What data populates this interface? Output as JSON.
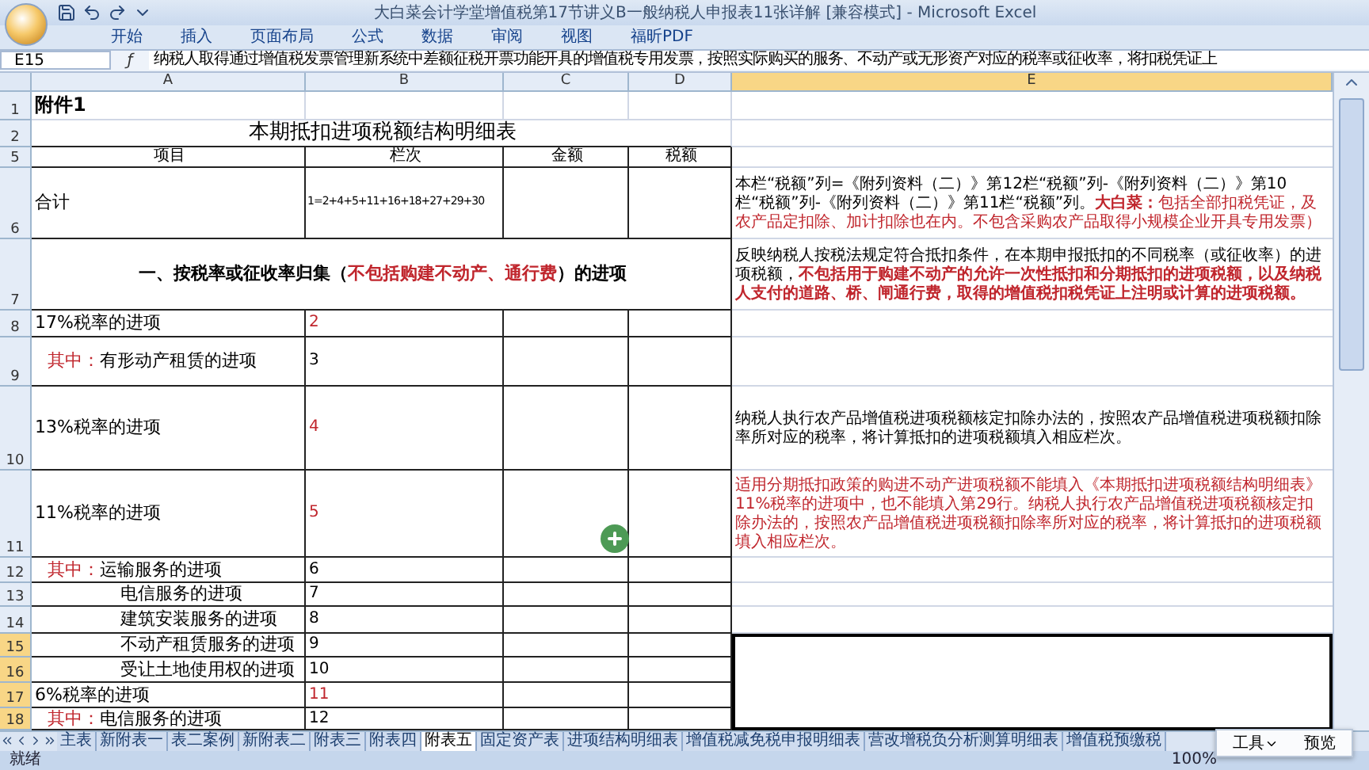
{
  "window": {
    "title": "大白菜会计学堂增值税第17节讲义B一般纳税人申报表11张详解  [兼容模式] - Microsoft Excel"
  },
  "ribbon_tabs": [
    {
      "label": "开始",
      "selected": false
    },
    {
      "label": "插入",
      "selected": false
    },
    {
      "label": "页面布局",
      "selected": false
    },
    {
      "label": "公式",
      "selected": false
    },
    {
      "label": "数据",
      "selected": false
    },
    {
      "label": "审阅",
      "selected": false
    },
    {
      "label": "视图",
      "selected": false
    },
    {
      "label": "福昕PDF",
      "selected": false
    }
  ],
  "formula_bar": {
    "name_box": "E15",
    "function_label": "ƒ",
    "formula": "纳税人取得通过增值税发票管理新系统中差额征税开票功能开具的增值税专用发票，按照实际购买的服务、不动产或无形资产对应的税率或征收率，将扣税凭证上"
  },
  "columns": [
    {
      "label": "A",
      "selected": false
    },
    {
      "label": "B",
      "selected": false
    },
    {
      "label": "C",
      "selected": false
    },
    {
      "label": "D",
      "selected": false
    },
    {
      "label": "E",
      "selected": true
    }
  ],
  "rows": [
    {
      "number": "1",
      "selected": false,
      "kind": "caption",
      "item": [
        {
          "text": "附件1",
          "kind": "plain"
        }
      ]
    },
    {
      "number": "2",
      "selected": false,
      "kind": "title",
      "item": [
        {
          "text": "本期抵扣进项税额结构明细表",
          "kind": "plain"
        }
      ]
    },
    {
      "number": "5",
      "selected": false,
      "kind": "header",
      "cells": [
        "项目",
        "栏次",
        "金额",
        "税额"
      ]
    },
    {
      "number": "6",
      "selected": false,
      "kind": "item",
      "item": [
        {
          "text": "合计",
          "kind": "plain"
        }
      ],
      "line": "1=2+4+5+11+16+18+27+29+30",
      "emphasis": false,
      "note": [
        {
          "text": "本栏“税额”列=《附列资料（二）》第12栏“税额”列-《附列资料（二）》第10栏“税额”列-《附列资料（二）》第11栏“税额”列。",
          "kind": "plain"
        },
        {
          "text": "大白菜：",
          "kind": "red-bold"
        },
        {
          "text": "包括全部扣税凭证，及农产品定扣除、加计扣除也在内。不包含采购农产品取得小规模企业开具专用发票）",
          "kind": "red"
        }
      ]
    },
    {
      "number": "7",
      "selected": false,
      "kind": "section",
      "item": [
        {
          "text": "一、按税率或征收率归集（",
          "kind": "bold"
        },
        {
          "text": "不包括购建不动产、通行费",
          "kind": "red-bold"
        },
        {
          "text": "）的进项",
          "kind": "bold"
        }
      ],
      "note": [
        {
          "text": "反映纳税人按税法规定符合抵扣条件，在本期申报抵扣的不同税率（或征收率）的进项税额，",
          "kind": "plain"
        },
        {
          "text": "不包括用于购建不动产的允许一次性抵扣和分期抵扣的进项税额，以及纳税人支付的道路、桥、闸通行费，取得的增值税扣税凭证上注明或计算的进项税额。",
          "kind": "red-bold"
        }
      ]
    },
    {
      "number": "8",
      "selected": false,
      "kind": "item",
      "item": [
        {
          "text": "17%税率的进项",
          "kind": "plain"
        }
      ],
      "line": "2",
      "emphasis": true
    },
    {
      "number": "9",
      "selected": false,
      "kind": "sub",
      "item": [
        {
          "text": "其中：",
          "kind": "red"
        },
        {
          "text": "有形动产租赁的进项",
          "kind": "plain"
        }
      ],
      "line": "3",
      "emphasis": false
    },
    {
      "number": "10",
      "selected": false,
      "kind": "item",
      "item": [
        {
          "text": "13%税率的进项",
          "kind": "plain"
        }
      ],
      "line": "4",
      "emphasis": true,
      "note": [
        {
          "text": "纳税人执行农产品增值税进项税额核定扣除办法的，按照农产品增值税进项税额扣除率所对应的税率，将计算抵扣的进项税额填入相应栏次。",
          "kind": "plain"
        }
      ]
    },
    {
      "number": "11",
      "selected": false,
      "kind": "item",
      "item": [
        {
          "text": "11%税率的进项",
          "kind": "plain"
        }
      ],
      "line": "5",
      "emphasis": true,
      "note": [
        {
          "text": "适用分期抵扣政策的购进不动产进项税额不能填入《本期抵扣进项税额结构明细表》11%税率的进项中，也不能填入第29行。纳税人执行农产品增值税进项税额核定扣除办法的，按照农产品增值税进项税额扣除率所对应的税率，将计算抵扣的进项税额填入相应栏次。",
          "kind": "red"
        }
      ]
    },
    {
      "number": "12",
      "selected": false,
      "kind": "sub",
      "item": [
        {
          "text": "其中：",
          "kind": "red"
        },
        {
          "text": "运输服务的进项",
          "kind": "plain"
        }
      ],
      "line": "6",
      "emphasis": false
    },
    {
      "number": "13",
      "selected": false,
      "kind": "sub2",
      "item": [
        {
          "text": "电信服务的进项",
          "kind": "plain"
        }
      ],
      "line": "7",
      "emphasis": false
    },
    {
      "number": "14",
      "selected": false,
      "kind": "sub2",
      "item": [
        {
          "text": "建筑安装服务的进项",
          "kind": "plain"
        }
      ],
      "line": "8",
      "emphasis": false
    },
    {
      "number": "15",
      "selected": true,
      "kind": "sub2",
      "item": [
        {
          "text": "不动产租赁服务的进项",
          "kind": "plain"
        }
      ],
      "line": "9",
      "emphasis": false
    },
    {
      "number": "16",
      "selected": true,
      "kind": "sub2",
      "item": [
        {
          "text": "受让土地使用权的进项",
          "kind": "plain"
        }
      ],
      "line": "10",
      "emphasis": false
    },
    {
      "number": "17",
      "selected": true,
      "kind": "item",
      "item": [
        {
          "text": "6%税率的进项",
          "kind": "plain"
        }
      ],
      "line": "11",
      "emphasis": true
    },
    {
      "number": "18",
      "selected": true,
      "kind": "sub",
      "item": [
        {
          "text": "其中：",
          "kind": "red"
        },
        {
          "text": "电信服务的进项",
          "kind": "plain"
        }
      ],
      "line": "12",
      "emphasis": false
    }
  ],
  "sheet_tabs": [
    {
      "label": "主表",
      "selected": false
    },
    {
      "label": "新附表一",
      "selected": false
    },
    {
      "label": "表二案例",
      "selected": false
    },
    {
      "label": "新附表二",
      "selected": false
    },
    {
      "label": "附表三",
      "selected": false
    },
    {
      "label": "附表四",
      "selected": false
    },
    {
      "label": "附表五",
      "selected": true
    },
    {
      "label": "固定资产表",
      "selected": false
    },
    {
      "label": "进项结构明细表",
      "selected": false
    },
    {
      "label": "增值税减免税申报明细表",
      "selected": false
    },
    {
      "label": "营改增税负分析测算明细表",
      "selected": false
    },
    {
      "label": "增值税预缴税",
      "selected": false
    }
  ],
  "floating_toolbar": [
    "工具",
    "预览"
  ],
  "status_bar": {
    "status": "就绪",
    "zoom": "100%"
  }
}
